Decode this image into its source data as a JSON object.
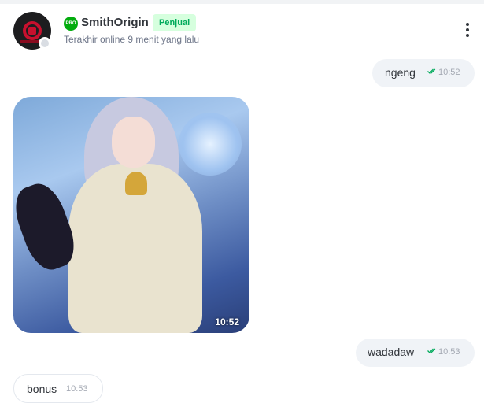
{
  "header": {
    "pro_label": "PRO",
    "shop_name": "SmithOrigin",
    "seller_badge": "Penjual",
    "last_online": "Terakhir online 9 menit yang lalu"
  },
  "messages": [
    {
      "direction": "out",
      "type": "text",
      "text": "ngeng",
      "time": "10:52",
      "read": true
    },
    {
      "direction": "in",
      "type": "image",
      "time": "10:52"
    },
    {
      "direction": "out",
      "type": "text",
      "text": "wadadaw",
      "time": "10:53",
      "read": true
    },
    {
      "direction": "in",
      "type": "text",
      "text": "bonus",
      "time": "10:53"
    }
  ],
  "colors": {
    "brand_green": "#03ac0e",
    "seller_badge_bg": "#d6ffde",
    "seller_badge_text": "#00aa5b",
    "outgoing_bubble": "#f0f3f7",
    "read_check": "#00aa5b"
  },
  "icons": {
    "pro": "pro-badge-icon",
    "menu": "more-vertical-icon",
    "read": "double-check-icon"
  }
}
